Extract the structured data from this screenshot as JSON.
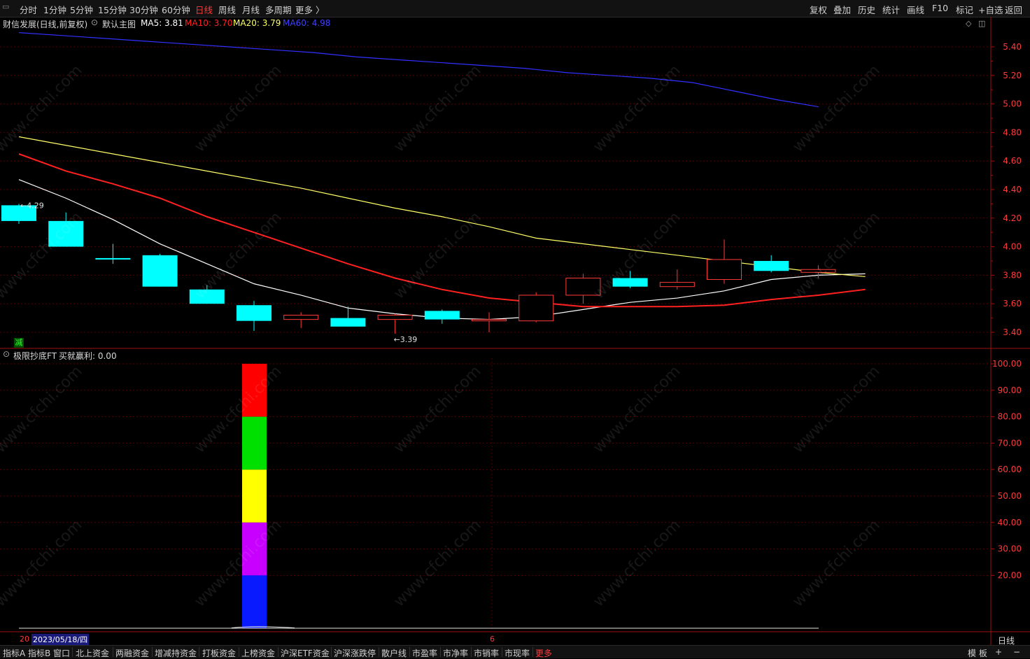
{
  "toolbar": {
    "menu_icon": "▭",
    "periods": [
      "分时",
      "1分钟",
      "5分钟",
      "15分钟",
      "30分钟",
      "60分钟",
      "日线",
      "周线",
      "月线",
      "多周期",
      "更多 〉"
    ],
    "active_period": "日线",
    "right_buttons": [
      "复权",
      "叠加",
      "历史",
      "统计",
      "画线",
      "F10",
      "标记",
      "+自选",
      "返回"
    ]
  },
  "main_header": {
    "title": "财信发展(日线,前复权)",
    "indicator": "默认主图",
    "ma5_label": "MA5: 3.81",
    "ma10_label": "MA10: 3.70",
    "ma20_label": "MA20: 3.79",
    "ma60_label": "MA60: 4.98",
    "colors": {
      "ma5": "#ffffff",
      "ma10": "#ff2020",
      "ma20": "#ffff66",
      "ma60": "#3030ff"
    }
  },
  "sub_header": {
    "indicator": "极限抄底FT",
    "value_label": "买就赢利: 0.00"
  },
  "jian_badge": "减",
  "annotations": {
    "high_label": "4.29",
    "low_label": "3.39"
  },
  "x_axis": {
    "left_label": "20",
    "cursor_date": "2023/05/18/四",
    "mid_label": "6",
    "period_label": "日线"
  },
  "watermark": "www.cfchi.com",
  "chart_data": [
    {
      "type": "candlestick",
      "title": "财信发展(日线,前复权)",
      "y_ticks": [
        "5.40",
        "5.20",
        "5.00",
        "4.80",
        "4.60",
        "4.40",
        "4.20",
        "4.00",
        "3.80",
        "3.60",
        "3.40"
      ],
      "ylim": [
        3.29,
        5.52
      ],
      "up_color": "#ff3a3a",
      "down_color": "#00ffff",
      "candles": [
        {
          "o": 4.29,
          "h": 4.3,
          "l": 4.16,
          "c": 4.18
        },
        {
          "o": 4.18,
          "h": 4.24,
          "l": 4.0,
          "c": 4.0
        },
        {
          "o": 3.92,
          "h": 4.02,
          "l": 3.88,
          "c": 3.91
        },
        {
          "o": 3.94,
          "h": 3.95,
          "l": 3.72,
          "c": 3.72
        },
        {
          "o": 3.7,
          "h": 3.73,
          "l": 3.6,
          "c": 3.6
        },
        {
          "o": 3.59,
          "h": 3.62,
          "l": 3.41,
          "c": 3.48
        },
        {
          "o": 3.49,
          "h": 3.54,
          "l": 3.43,
          "c": 3.52
        },
        {
          "o": 3.5,
          "h": 3.58,
          "l": 3.44,
          "c": 3.44
        },
        {
          "o": 3.49,
          "h": 3.53,
          "l": 3.39,
          "c": 3.52
        },
        {
          "o": 3.55,
          "h": 3.56,
          "l": 3.46,
          "c": 3.49
        },
        {
          "o": 3.48,
          "h": 3.54,
          "l": 3.4,
          "c": 3.49
        },
        {
          "o": 3.48,
          "h": 3.68,
          "l": 3.47,
          "c": 3.66
        },
        {
          "o": 3.66,
          "h": 3.81,
          "l": 3.6,
          "c": 3.78
        },
        {
          "o": 3.78,
          "h": 3.83,
          "l": 3.71,
          "c": 3.72
        },
        {
          "o": 3.72,
          "h": 3.84,
          "l": 3.7,
          "c": 3.75
        },
        {
          "o": 3.77,
          "h": 4.05,
          "l": 3.74,
          "c": 3.91
        },
        {
          "o": 3.9,
          "h": 3.94,
          "l": 3.82,
          "c": 3.83
        },
        {
          "o": 3.82,
          "h": 3.87,
          "l": 3.78,
          "c": 3.84
        }
      ],
      "series": [
        {
          "name": "MA5",
          "color": "#ffffff",
          "values": [
            4.47,
            4.34,
            4.19,
            4.02,
            3.88,
            3.74,
            3.66,
            3.57,
            3.53,
            3.5,
            3.49,
            3.51,
            3.56,
            3.61,
            3.64,
            3.69,
            3.77,
            3.8,
            3.81
          ]
        },
        {
          "name": "MA10",
          "color": "#ff2020",
          "values": [
            4.65,
            4.53,
            4.44,
            4.34,
            4.21,
            4.1,
            3.99,
            3.88,
            3.78,
            3.7,
            3.64,
            3.61,
            3.58,
            3.58,
            3.58,
            3.59,
            3.63,
            3.66,
            3.7
          ]
        },
        {
          "name": "MA20",
          "color": "#ffff66",
          "values": [
            4.77,
            4.71,
            4.65,
            4.59,
            4.53,
            4.47,
            4.41,
            4.34,
            4.27,
            4.21,
            4.14,
            4.06,
            4.02,
            3.98,
            3.94,
            3.9,
            3.86,
            3.82,
            3.79
          ]
        },
        {
          "name": "MA60",
          "color": "#3030ff",
          "values": [
            5.5,
            5.48,
            5.46,
            5.44,
            5.42,
            5.4,
            5.38,
            5.36,
            5.33,
            5.31,
            5.29,
            5.27,
            5.25,
            5.22,
            5.2,
            5.18,
            5.15,
            5.09,
            5.03,
            4.98
          ]
        }
      ]
    },
    {
      "type": "bar",
      "title": "极限抄底FT",
      "y_ticks": [
        "100.00",
        "90.00",
        "80.00",
        "70.00",
        "60.00",
        "50.00",
        "40.00",
        "30.00",
        "20.00"
      ],
      "ylim": [
        0,
        100
      ],
      "bar_index": 5,
      "stacked_segments": [
        {
          "from": 0,
          "to": 20,
          "color": "#0a1aff"
        },
        {
          "from": 20,
          "to": 40,
          "color": "#c800ff"
        },
        {
          "from": 40,
          "to": 60,
          "color": "#ffff00"
        },
        {
          "from": 60,
          "to": 80,
          "color": "#00e000"
        },
        {
          "from": 80,
          "to": 100,
          "color": "#ff0000"
        }
      ],
      "baseline_value": 0.0
    }
  ]
}
